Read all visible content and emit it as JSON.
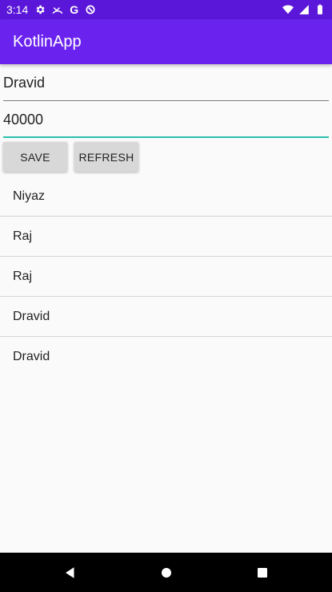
{
  "status_bar": {
    "time": "3:14",
    "icons_left": [
      "gear-icon",
      "missed-call-icon",
      "google-g-icon",
      "data-saver-icon"
    ],
    "g_letter": "G",
    "icons_right": [
      "wifi-icon",
      "cell-signal-icon",
      "battery-icon"
    ]
  },
  "app_bar": {
    "title": "KotlinApp"
  },
  "form": {
    "name_value": "Dravid",
    "salary_value": "40000"
  },
  "buttons": {
    "save_label": "SAVE",
    "refresh_label": "REFRESH"
  },
  "list": {
    "items": [
      {
        "label": "Niyaz"
      },
      {
        "label": "Raj"
      },
      {
        "label": "Raj"
      },
      {
        "label": "Dravid"
      },
      {
        "label": "Dravid"
      }
    ]
  },
  "nav_bar": {
    "icons": [
      "back-icon",
      "home-icon",
      "recents-icon"
    ]
  },
  "colors": {
    "status_bar": "#5b17d9",
    "app_bar": "#6a22ee",
    "accent": "#2bbfae"
  }
}
